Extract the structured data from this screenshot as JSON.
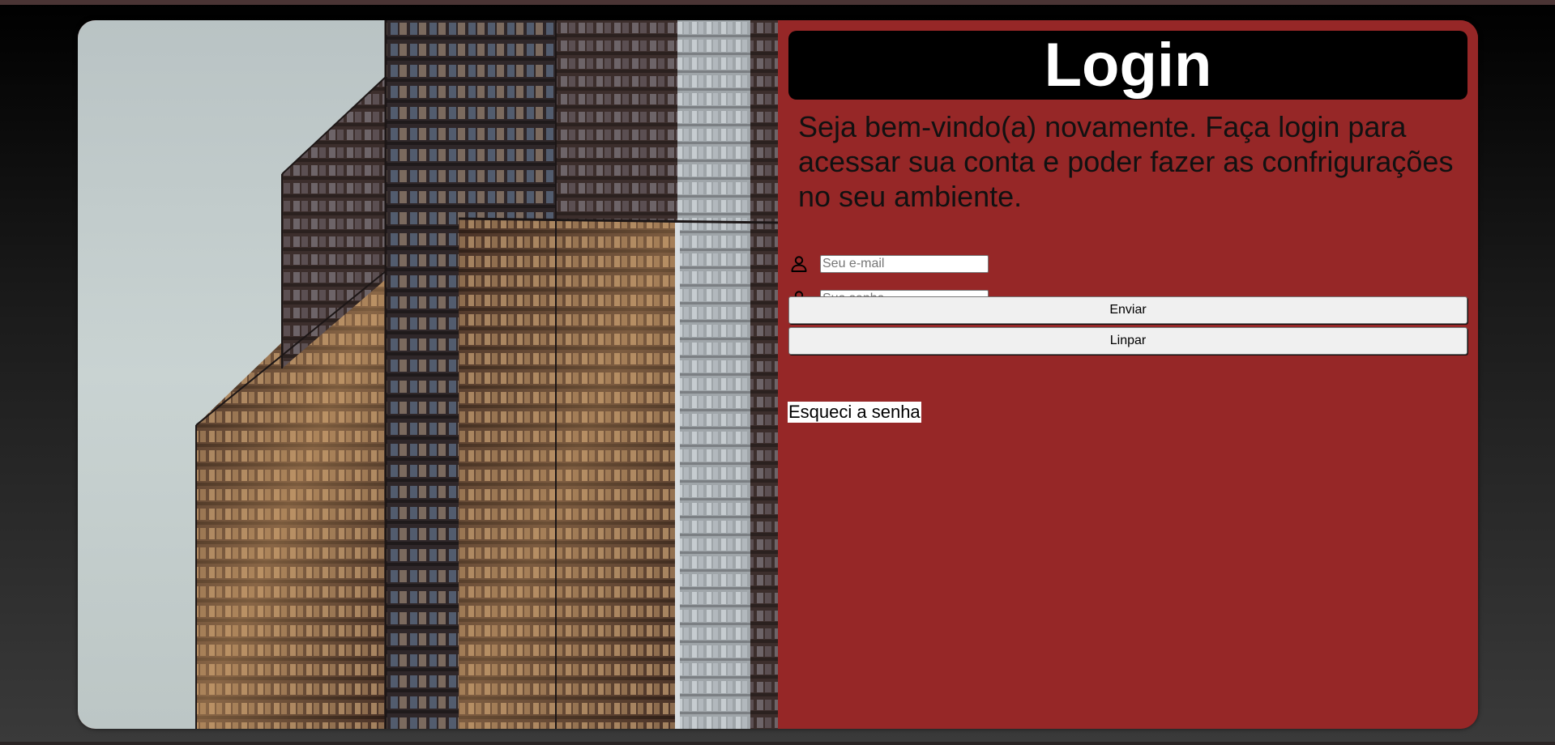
{
  "login": {
    "title": "Login",
    "welcome_text": "Seja bem-vindo(a) novamente. Faça login para acessar sua conta e poder fazer as confrigurações no seu ambiente.",
    "email_placeholder": "Seu e-mail",
    "password_placeholder": "Sua senha",
    "submit_label": "Enviar",
    "clear_label": "Linpar",
    "forgot_label": "Esqueci a senha"
  },
  "icons": {
    "email_field_icon": "user-icon",
    "password_field_icon": "user-icon"
  },
  "colors": {
    "panel_background": "#962727",
    "title_background": "#000000",
    "title_text": "#ffffff"
  }
}
